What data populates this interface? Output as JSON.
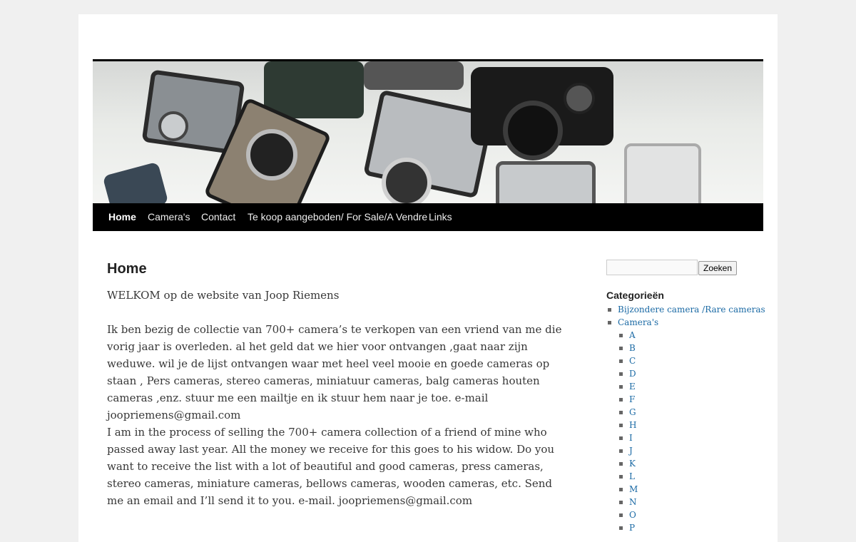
{
  "nav": {
    "items": [
      "Home",
      "Camera's",
      "Contact",
      "Te koop aangeboden/ For Sale/A Vendre",
      "Links"
    ]
  },
  "main": {
    "title": "Home",
    "welcome": "WELKOM op de website van Joop Riemens",
    "dutch": "Ik ben bezig de collectie van 700+ camera’s te verkopen van een vriend van me die vorig jaar is overleden. al het geld dat we hier voor ontvangen ,gaat naar zijn weduwe. wil je de lijst ontvangen waar met heel veel mooie en goede cameras op staan , Pers cameras, stereo cameras, miniatuur cameras, balg cameras houten cameras ,enz. stuur me een mailtje en ik stuur hem naar je toe.  e-mail joopriemens@gmail.com",
    "english": "I am in the process of selling the 700+ camera collection of a friend of mine who passed away last year. All the money we receive for this goes to his widow. Do you want to receive the list with a lot of beautiful and good cameras, press cameras, stereo cameras, miniature cameras, bellows cameras, wooden cameras, etc. Send me an email and I’ll send it to you. e-mail. joopriemens@gmail.com"
  },
  "sidebar": {
    "search_button": "Zoeken",
    "categories_title": "Categorieën",
    "categories": [
      "Bijzondere camera /Rare cameras",
      "Camera's"
    ],
    "letters": [
      "A",
      "B",
      "C",
      "D",
      "E",
      "F",
      "G",
      "H",
      "I",
      "J",
      "K",
      "L",
      "M",
      "N",
      "O",
      "P"
    ]
  }
}
